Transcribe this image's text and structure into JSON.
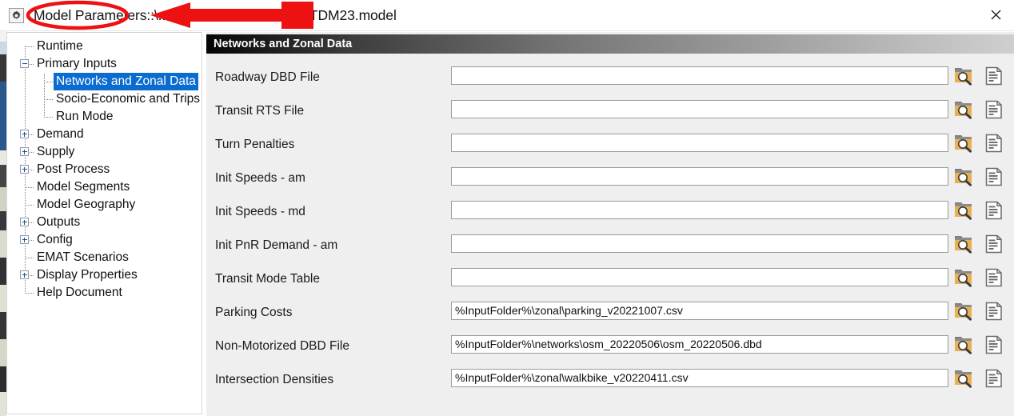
{
  "window": {
    "app_icon": "gear-icon",
    "title_prefix": "Model Parameters:",
    "title_path": ":\\...\\TDM\\...\\tdm23\\CTPS_TDM23.model",
    "title_path_visible_tail": ")\\tdm23\\CTPS_TDM23.model",
    "close_label": "✕"
  },
  "annotations": {
    "color": "#ee1111",
    "ellipse_target": "Model Parameters:",
    "arrow_note": "redaction arrow over file path"
  },
  "sidebar": {
    "items": [
      {
        "label": "Runtime",
        "level": 1,
        "toggle": "none",
        "selected": false
      },
      {
        "label": "Primary Inputs",
        "level": 1,
        "toggle": "minus",
        "selected": false
      },
      {
        "label": "Networks and Zonal Data",
        "level": 2,
        "toggle": "none",
        "selected": true
      },
      {
        "label": "Socio-Economic and Trips",
        "level": 2,
        "toggle": "none",
        "selected": false
      },
      {
        "label": "Run Mode",
        "level": 2,
        "toggle": "none",
        "selected": false
      },
      {
        "label": "Demand",
        "level": 1,
        "toggle": "plus",
        "selected": false
      },
      {
        "label": "Supply",
        "level": 1,
        "toggle": "plus",
        "selected": false
      },
      {
        "label": "Post Process",
        "level": 1,
        "toggle": "plus",
        "selected": false
      },
      {
        "label": "Model Segments",
        "level": 1,
        "toggle": "none",
        "selected": false
      },
      {
        "label": "Model Geography",
        "level": 1,
        "toggle": "none",
        "selected": false
      },
      {
        "label": "Outputs",
        "level": 1,
        "toggle": "plus",
        "selected": false
      },
      {
        "label": "Config",
        "level": 1,
        "toggle": "plus",
        "selected": false
      },
      {
        "label": "EMAT Scenarios",
        "level": 1,
        "toggle": "none",
        "selected": false
      },
      {
        "label": "Display Properties",
        "level": 1,
        "toggle": "plus",
        "selected": false
      },
      {
        "label": "Help Document",
        "level": 1,
        "toggle": "none",
        "selected": false
      }
    ],
    "selected_bg": "#0a6cd0"
  },
  "main": {
    "header": "Networks and Zonal Data",
    "rows": [
      {
        "label": "Roadway DBD File",
        "value": "",
        "placeholder": ""
      },
      {
        "label": "Transit RTS File",
        "value": "",
        "placeholder": ""
      },
      {
        "label": "Turn Penalties",
        "value": "",
        "placeholder": ""
      },
      {
        "label": "Init Speeds - am",
        "value": "",
        "placeholder": ""
      },
      {
        "label": "Init Speeds - md",
        "value": "",
        "placeholder": ""
      },
      {
        "label": "Init PnR Demand - am",
        "value": "",
        "placeholder": ""
      },
      {
        "label": "Transit Mode Table",
        "value": "",
        "placeholder": ""
      },
      {
        "label": "Parking Costs",
        "value": "%InputFolder%\\zonal\\parking_v20221007.csv",
        "placeholder": ""
      },
      {
        "label": "Non-Motorized DBD File",
        "value": "%InputFolder%\\networks\\osm_20220506\\osm_20220506.dbd",
        "placeholder": ""
      },
      {
        "label": "Intersection Densities",
        "value": "%InputFolder%\\zonal\\walkbike_v20220411.csv",
        "placeholder": ""
      }
    ],
    "browse_icon": "folder-search-icon",
    "doc_icon": "document-icon",
    "folder_color": "#e8b055"
  }
}
